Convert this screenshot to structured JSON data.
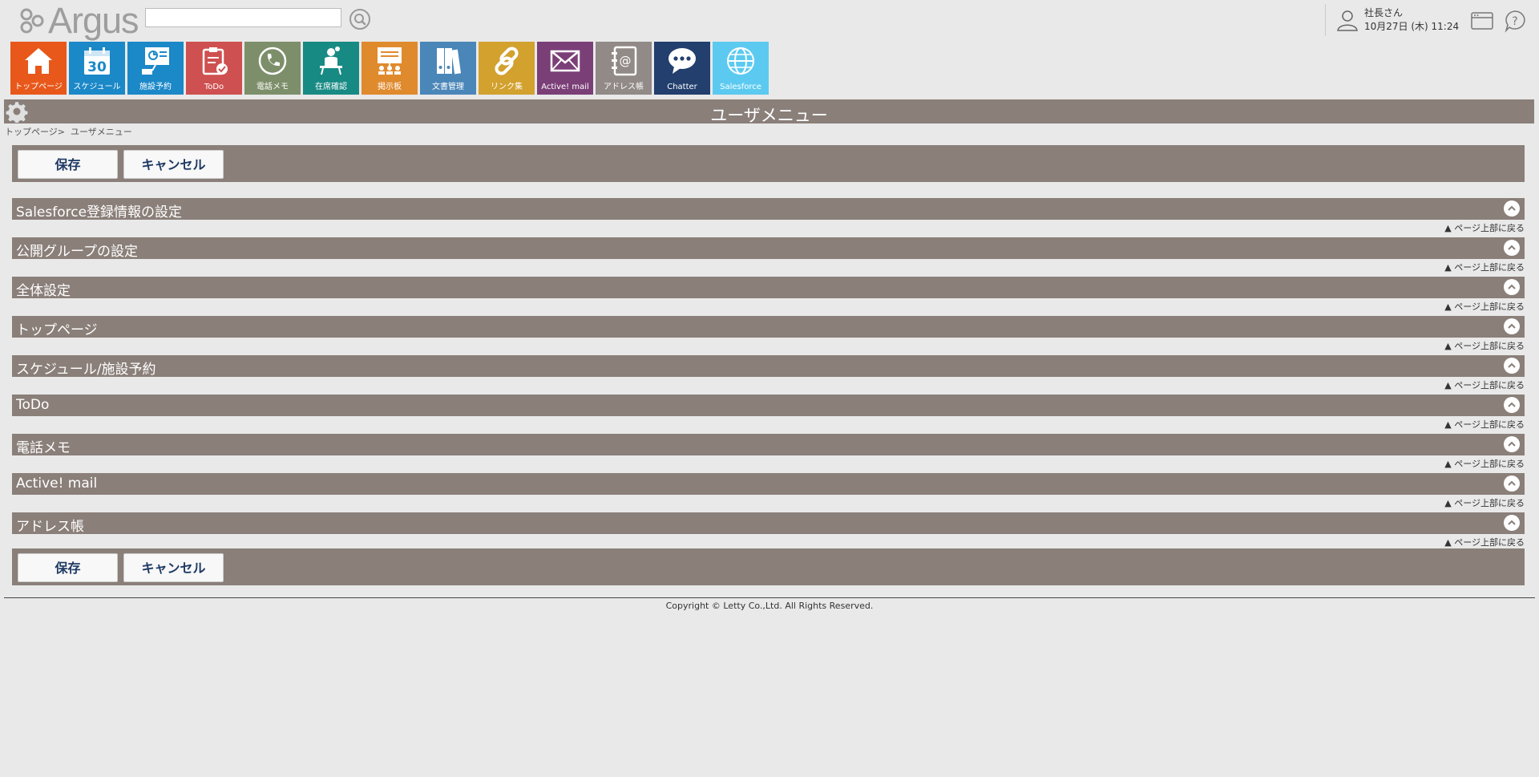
{
  "logo": {
    "text": "Argus"
  },
  "search": {
    "placeholder": "",
    "value": ""
  },
  "user": {
    "name": "社長さん",
    "datetime": "10月27日 (木) 11:24"
  },
  "apps": [
    {
      "label": "トップページ",
      "color": "#e8581a",
      "icon": "home-icon"
    },
    {
      "label": "スケジュール",
      "color": "#1b88c8",
      "icon": "calendar-icon",
      "day": "30"
    },
    {
      "label": "施設予約",
      "color": "#1b88c8",
      "icon": "facility-icon"
    },
    {
      "label": "ToDo",
      "color": "#cf5050",
      "icon": "todo-icon"
    },
    {
      "label": "電話メモ",
      "color": "#7d8f6a",
      "icon": "phone-icon"
    },
    {
      "label": "在席確認",
      "color": "#188a84",
      "icon": "presence-icon"
    },
    {
      "label": "掲示板",
      "color": "#e08a2e",
      "icon": "board-icon"
    },
    {
      "label": "文書管理",
      "color": "#4b86b8",
      "icon": "document-icon"
    },
    {
      "label": "リンク集",
      "color": "#d2a12e",
      "icon": "link-icon"
    },
    {
      "label": "Active! mail",
      "color": "#7b3f78",
      "icon": "mail-icon"
    },
    {
      "label": "アドレス帳",
      "color": "#918a86",
      "icon": "addressbook-icon"
    },
    {
      "label": "Chatter",
      "color": "#223f6e",
      "icon": "chat-icon"
    },
    {
      "label": "Salesforce",
      "color": "#5ccaf0",
      "icon": "globe-icon"
    }
  ],
  "page_title": "ユーザメニュー",
  "breadcrumb": {
    "home": "トップページ",
    "separator": ">",
    "current": "ユーザメニュー"
  },
  "buttons": {
    "save": "保存",
    "cancel": "キャンセル"
  },
  "sections": [
    "Salesforce登録情報の設定",
    "公開グループの設定",
    "全体設定",
    "トップページ",
    "スケジュール/施設予約",
    "ToDo",
    "電話メモ",
    "Active! mail",
    "アドレス帳"
  ],
  "back_to_top": "▲ ページ上部に戻る",
  "copyright": "Copyright © Letty Co.,Ltd. All Rights Reserved."
}
